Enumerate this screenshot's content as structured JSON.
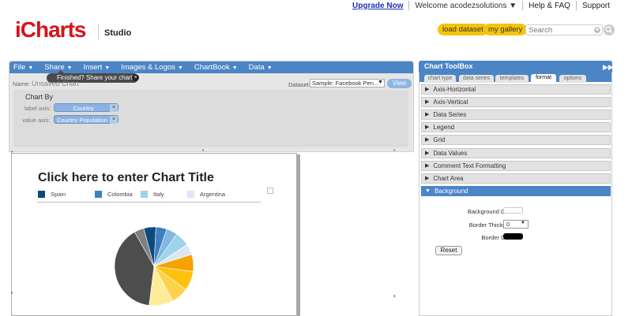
{
  "topnav": {
    "upgrade": "Upgrade Now",
    "welcome": "Welcome acodezsolutions ▼",
    "help": "Help & FAQ",
    "support": "Support"
  },
  "header": {
    "logo": "iCharts",
    "product": "Studio",
    "load_dataset": "load dataset",
    "my_gallery": "my gallery",
    "search_placeholder": "Search",
    "search_clear": "⊗",
    "search_icon": "magnifier-icon"
  },
  "menubar": {
    "items": [
      {
        "label": "File"
      },
      {
        "label": "Share"
      },
      {
        "label": "Insert"
      },
      {
        "label": "Images & Logos"
      },
      {
        "label": "ChartBook"
      },
      {
        "label": "Data"
      }
    ],
    "caret": "▼"
  },
  "tooltip": {
    "text": "Finished? Share your chart.",
    "close": "×"
  },
  "editor": {
    "name_label": "Name:",
    "name_value": "Unsaved Chart",
    "dataset_label": "Dataset:",
    "dataset_value": "Sample: Facebook Pen...",
    "view_button": "View"
  },
  "chart_by": {
    "title": "Chart By",
    "label_axis_label": "label axis:",
    "label_axis_value": "Country",
    "value_axis_label": "value axis:",
    "value_axis_value": "Country Population ...",
    "remove": "×"
  },
  "chart": {
    "title": "Click here to enter Chart Title",
    "legend": [
      {
        "name": "Spain",
        "color": "#0b4a7d"
      },
      {
        "name": "Colombia",
        "color": "#3f7fbf"
      },
      {
        "name": "Italy",
        "color": "#9ed3e8"
      },
      {
        "name": "Argentina",
        "color": "#dce7f3"
      }
    ],
    "pie_colors": [
      "#4d4d4d",
      "#7f7f7f",
      "#0b4a7d",
      "#3f7fbf",
      "#7fb8e0",
      "#9ed3e8",
      "#dce7f3",
      "#f5a300",
      "#ffc20e",
      "#ffd24d",
      "#ffec9a"
    ],
    "pie_shares": [
      0.4,
      0.04,
      0.05,
      0.045,
      0.045,
      0.06,
      0.045,
      0.07,
      0.08,
      0.07,
      0.1
    ]
  },
  "toolbox": {
    "title": "Chart ToolBox",
    "collapse": "▶▶",
    "tabs": [
      {
        "label": "chart type",
        "active": false
      },
      {
        "label": "data series",
        "active": false
      },
      {
        "label": "templates",
        "active": false
      },
      {
        "label": "format",
        "active": true
      },
      {
        "label": "options",
        "active": false
      }
    ],
    "sections": [
      {
        "label": "Axis-Horizontal",
        "expanded": false
      },
      {
        "label": "Axis-Vertical",
        "expanded": false
      },
      {
        "label": "Data Series",
        "expanded": false
      },
      {
        "label": "Legend",
        "expanded": false
      },
      {
        "label": "Grid",
        "expanded": false
      },
      {
        "label": "Data Values",
        "expanded": false
      },
      {
        "label": "Comment Text Formatting",
        "expanded": false
      },
      {
        "label": "Chart Area",
        "expanded": false
      },
      {
        "label": "Background",
        "expanded": true
      }
    ],
    "background": {
      "bg_color_label": "Background Color:",
      "bg_color": "#ffffff",
      "border_thickness_label": "Border Thickness:",
      "border_thickness_value": "0",
      "border_color_label": "Border Color:",
      "border_color": "#000000",
      "reset": "Reset"
    }
  }
}
